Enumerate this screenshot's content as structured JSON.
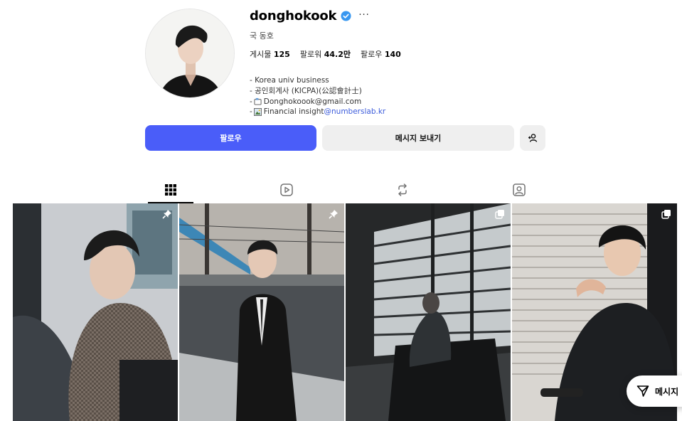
{
  "profile": {
    "username": "donghokook",
    "full_name": "국 동호",
    "stats": [
      {
        "label": "게시물",
        "value": "125"
      },
      {
        "label": "팔로워",
        "value": "44.2만"
      },
      {
        "label": "팔로우",
        "value": "140"
      }
    ],
    "bio": {
      "line1": "- Korea univ business",
      "line2": "- 공인회계사 (KICPA)(公認會計士)",
      "line3_prefix": "- ",
      "line3_text": "Donghokoook@gmail.com",
      "line4_prefix": "- ",
      "line4_text": "Financial insight ",
      "line4_link": "@numberslab.kr"
    }
  },
  "actions": {
    "follow_label": "팔로우",
    "message_label": "메시지 보내기"
  },
  "tabs": [
    {
      "name": "posts",
      "icon": "grid-icon",
      "active": true
    },
    {
      "name": "reels",
      "icon": "reels-icon",
      "active": false
    },
    {
      "name": "reposts",
      "icon": "repost-icon",
      "active": false
    },
    {
      "name": "tagged",
      "icon": "tagged-icon",
      "active": false
    }
  ],
  "posts": [
    {
      "badge": "pin-icon"
    },
    {
      "badge": "pin-icon"
    },
    {
      "badge": "carousel-icon"
    },
    {
      "badge": "carousel-icon"
    }
  ],
  "floating": {
    "messages_label": "메시지"
  },
  "colors": {
    "primary": "#4a5df9",
    "verified": "#3897f0",
    "link": "#3b5bdb"
  }
}
